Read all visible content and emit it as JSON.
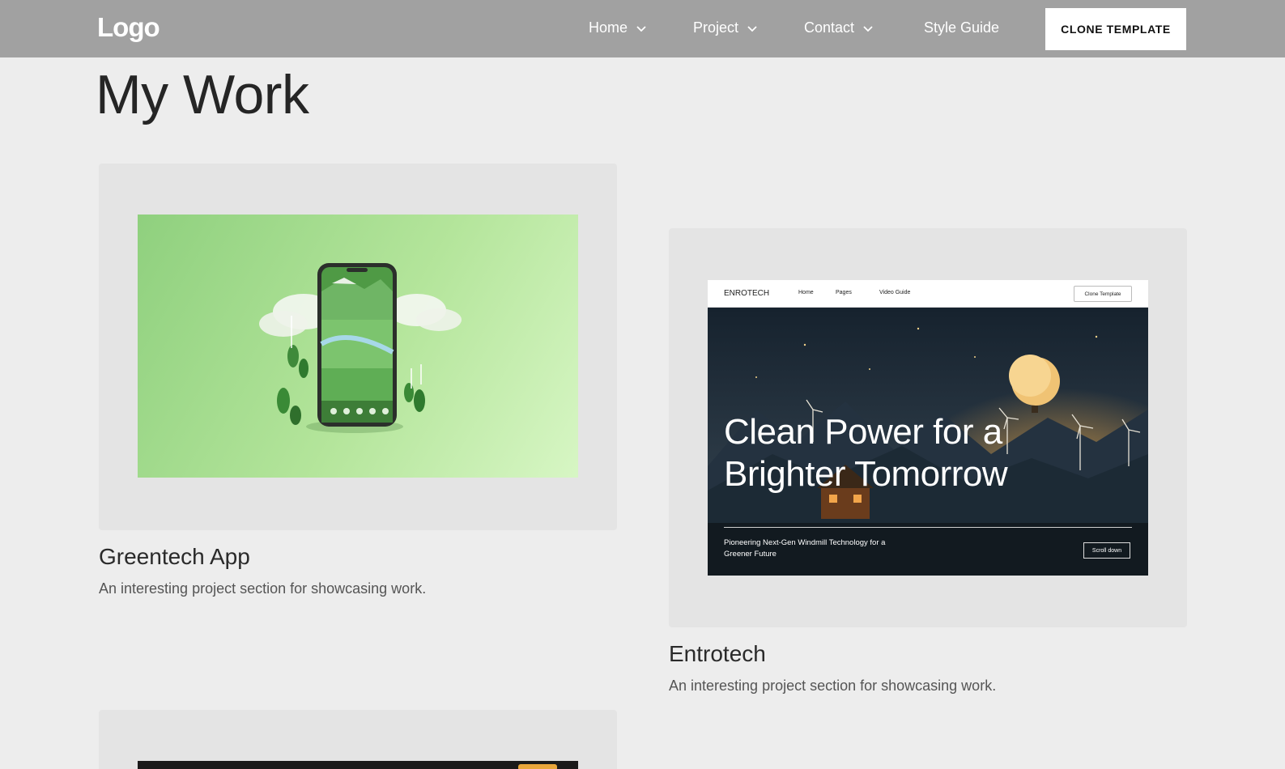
{
  "header": {
    "logo": "Logo",
    "nav": [
      {
        "label": "Home",
        "has_dropdown": true
      },
      {
        "label": "Project",
        "has_dropdown": true
      },
      {
        "label": "Contact",
        "has_dropdown": true
      },
      {
        "label": "Style Guide",
        "has_dropdown": false
      }
    ],
    "cta_label": "CLONE TEMPLATE"
  },
  "main": {
    "title": "My Work",
    "projects": [
      {
        "title": "Greentech App",
        "description": "An interesting project section for showcasing work."
      },
      {
        "title": "Entrotech",
        "description": "An interesting project section for showcasing work.",
        "preview": {
          "logo": "ENROTECH",
          "links": [
            "Home",
            "Pages",
            "Video Guide"
          ],
          "button": "Clone Template",
          "headline": "Clean Power for a Brighter Tomorrow",
          "subtext": "Pioneering Next-Gen Windmill Technology for a Greener Future",
          "scroll_label": "Scroll down"
        }
      }
    ]
  },
  "colors": {
    "header_bg": "#a1a1a1",
    "page_bg": "#ededed",
    "card_bg": "#e4e4e4",
    "green_accent": "#8fd07e"
  }
}
